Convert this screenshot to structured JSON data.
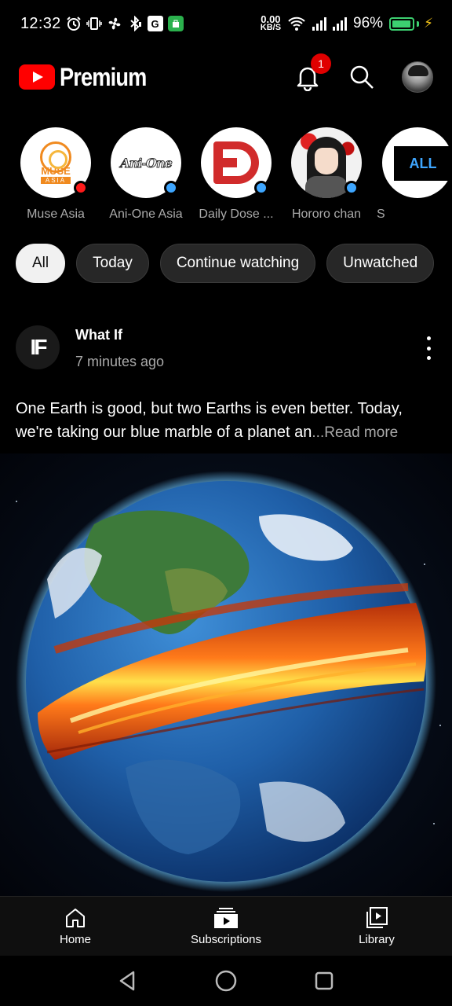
{
  "status_bar": {
    "time": "12:32",
    "net_speed_value": "0.00",
    "net_speed_unit": "KB/S",
    "battery": "96%",
    "battery_level": 0.96
  },
  "header": {
    "logo_text": "Premium",
    "notification_count": "1"
  },
  "channels": {
    "items": [
      {
        "name": "Muse Asia",
        "dot_color": "#ff1a1a"
      },
      {
        "name": "Ani-One Asia",
        "dot_color": "#3ea6ff",
        "logo_text": "Ani-One"
      },
      {
        "name": "Daily Dose ...",
        "dot_color": "#3ea6ff"
      },
      {
        "name": "Hororo chan",
        "dot_color": "#3ea6ff"
      }
    ],
    "partial_name": "S",
    "all_label": "ALL",
    "muse_word": "MUSE",
    "muse_sub": "ASIA"
  },
  "chips": [
    "All",
    "Today",
    "Continue watching",
    "Unwatched"
  ],
  "post": {
    "avatar_text": "IF",
    "channel": "What If",
    "time": "7 minutes ago",
    "text": "One Earth is good, but two Earths is even better. Today, we're taking our blue marble of a planet an",
    "ellipsis": "...",
    "read_more": "Read more"
  },
  "bottom_nav": {
    "home": "Home",
    "subscriptions": "Subscriptions",
    "library": "Library"
  },
  "colors": {
    "brand_red": "#ff0000",
    "link_blue": "#3ea6ff",
    "live_dot_red": "#ff1a1a",
    "battery_green": "#3cd070"
  }
}
